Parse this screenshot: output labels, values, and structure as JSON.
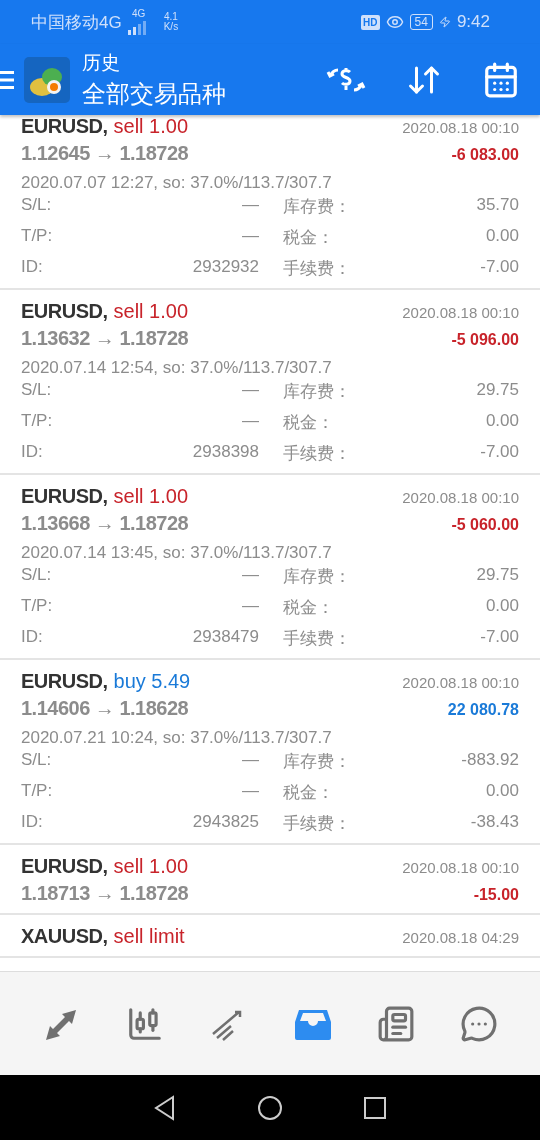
{
  "status_bar": {
    "carrier": "中国移动4G",
    "network": "4G",
    "speed": "4.1",
    "speed_unit": "K/s",
    "hd": "HD",
    "battery": "54",
    "time": "9:42"
  },
  "app_bar": {
    "title": "历史",
    "subtitle": "全部交易品种"
  },
  "deals": [
    {
      "symbol": "EURUSD,",
      "color": "#c8232a",
      "type": "sell 1.00",
      "close_time": "2020.08.18 00:10",
      "prices": "1.12645 → 1.18728",
      "profit": "-6 083.00",
      "open_info": "2020.07.07 12:27, so: 37.0%/113.7/307.7",
      "details": [
        {
          "label": "S/L:",
          "value": "—",
          "label2": "库存费：",
          "value2": "35.70"
        },
        {
          "label": "T/P:",
          "value": "—",
          "label2": "税金：",
          "value2": "0.00"
        },
        {
          "label": "ID:",
          "value": "2932932",
          "label2": "手续费：",
          "value2": "-7.00"
        }
      ]
    },
    {
      "symbol": "EURUSD,",
      "color": "#c8232a",
      "type": "sell 1.00",
      "close_time": "2020.08.18 00:10",
      "prices": "1.13632 → 1.18728",
      "profit": "-5 096.00",
      "open_info": "2020.07.14 12:54, so: 37.0%/113.7/307.7",
      "details": [
        {
          "label": "S/L:",
          "value": "—",
          "label2": "库存费：",
          "value2": "29.75"
        },
        {
          "label": "T/P:",
          "value": "—",
          "label2": "税金：",
          "value2": "0.00"
        },
        {
          "label": "ID:",
          "value": "2938398",
          "label2": "手续费：",
          "value2": "-7.00"
        }
      ]
    },
    {
      "symbol": "EURUSD,",
      "color": "#c8232a",
      "type": "sell 1.00",
      "close_time": "2020.08.18 00:10",
      "prices": "1.13668 → 1.18728",
      "profit": "-5 060.00",
      "open_info": "2020.07.14 13:45, so: 37.0%/113.7/307.7",
      "details": [
        {
          "label": "S/L:",
          "value": "—",
          "label2": "库存费：",
          "value2": "29.75"
        },
        {
          "label": "T/P:",
          "value": "—",
          "label2": "税金：",
          "value2": "0.00"
        },
        {
          "label": "ID:",
          "value": "2938479",
          "label2": "手续费：",
          "value2": "-7.00"
        }
      ]
    },
    {
      "symbol": "EURUSD,",
      "color": "#1a7ad8",
      "type": "buy 5.49",
      "close_time": "2020.08.18 00:10",
      "prices": "1.14606 → 1.18628",
      "profit": "22 080.78",
      "open_info": "2020.07.21 10:24, so: 37.0%/113.7/307.7",
      "details": [
        {
          "label": "S/L:",
          "value": "—",
          "label2": "库存费：",
          "value2": "-883.92"
        },
        {
          "label": "T/P:",
          "value": "—",
          "label2": "税金：",
          "value2": "0.00"
        },
        {
          "label": "ID:",
          "value": "2943825",
          "label2": "手续费：",
          "value2": "-38.43"
        }
      ]
    },
    {
      "symbol": "EURUSD,",
      "color": "#c8232a",
      "type": "sell 1.00",
      "close_time": "2020.08.18 00:10",
      "prices": "1.18713 → 1.18728",
      "profit": "-15.00"
    },
    {
      "symbol": "XAUUSD,",
      "color": "#c8232a",
      "type": "sell limit",
      "close_time": "2020.08.18 04:29"
    }
  ],
  "bottom_nav": [
    {
      "selected": false
    },
    {
      "selected": false
    },
    {
      "selected": false
    },
    {
      "selected": true
    },
    {
      "selected": false
    },
    {
      "selected": false
    }
  ]
}
